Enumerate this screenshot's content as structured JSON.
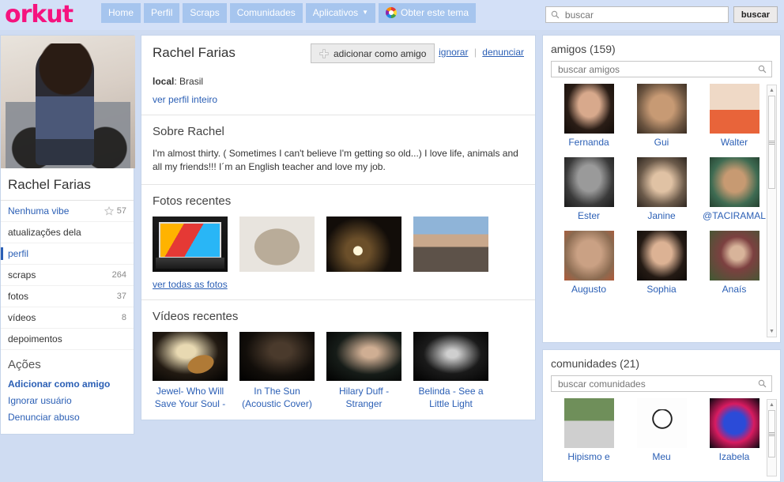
{
  "header": {
    "logo": "orkut",
    "nav": [
      {
        "label": "Home",
        "icon": null,
        "caret": false
      },
      {
        "label": "Perfil",
        "icon": null,
        "caret": false
      },
      {
        "label": "Scraps",
        "icon": null,
        "caret": false
      },
      {
        "label": "Comunidades",
        "icon": null,
        "caret": false
      },
      {
        "label": "Aplicativos",
        "icon": null,
        "caret": true
      },
      {
        "label": "Obter este tema",
        "icon": "palette-icon",
        "caret": false
      }
    ],
    "search": {
      "placeholder": "buscar",
      "value": "",
      "button": "buscar",
      "icon": "search-icon"
    }
  },
  "sidebar": {
    "photo_alt": "foto de perfil",
    "name": "Rachel Farias",
    "vibe": {
      "label": "Nenhuma vibe",
      "icon": "star-icon",
      "count": "57"
    },
    "items": [
      {
        "label": "atualizações dela",
        "count": "",
        "active": false,
        "link": false
      },
      {
        "label": "perfil",
        "count": "",
        "active": true,
        "link": true
      },
      {
        "label": "scraps",
        "count": "264",
        "active": false,
        "link": false
      },
      {
        "label": "fotos",
        "count": "37",
        "active": false,
        "link": false
      },
      {
        "label": "vídeos",
        "count": "8",
        "active": false,
        "link": false
      },
      {
        "label": "depoimentos",
        "count": "",
        "active": false,
        "link": false
      }
    ],
    "actions_title": "Ações",
    "actions": [
      {
        "label": "Adicionar como amigo",
        "bold": true
      },
      {
        "label": "Ignorar usuário",
        "bold": false
      },
      {
        "label": "Denunciar abuso",
        "bold": false
      }
    ]
  },
  "profile": {
    "name": "Rachel Farias",
    "add_friend": {
      "label": "adicionar como amigo",
      "icon": "plus-icon"
    },
    "ignore": "ignorar",
    "separator": "|",
    "report": "denunciar",
    "local_label": "local",
    "local_value": "Brasil",
    "full_profile": "ver perfil inteiro",
    "about_title": "Sobre Rachel",
    "about_text": "I'm almost thirty. ( Sometimes I can't believe I'm getting so old...) I love life, animals and all my friends!!! I´m an English teacher and love my job."
  },
  "photos": {
    "title": "Fotos recentes",
    "view_all": "ver todas as fotos",
    "items": [
      {
        "alt": "foto notebook com imagem de festa"
      },
      {
        "alt": "foto de cachorro shih tzu"
      },
      {
        "alt": "foto de show noturno"
      },
      {
        "alt": "foto de paisagem da cidade"
      }
    ]
  },
  "videos": {
    "title": "Vídeos recentes",
    "items": [
      {
        "title": "Jewel- Who Will Save Your Soul -"
      },
      {
        "title": "In The Sun (Acoustic Cover)"
      },
      {
        "title": "Hilary Duff - Stranger"
      },
      {
        "title": "Belinda - See a Little Light"
      }
    ]
  },
  "friends": {
    "title": "amigos (159)",
    "search": {
      "placeholder": "buscar amigos",
      "value": "",
      "icon": "search-icon"
    },
    "items": [
      {
        "name": "Fernanda"
      },
      {
        "name": "Gui"
      },
      {
        "name": "Walter"
      },
      {
        "name": "Ester"
      },
      {
        "name": "Janine"
      },
      {
        "name": "@TACIRAMAL"
      },
      {
        "name": "Augusto"
      },
      {
        "name": "Sophia"
      },
      {
        "name": "Anaís"
      }
    ]
  },
  "communities": {
    "title": "comunidades (21)",
    "search": {
      "placeholder": "buscar comunidades",
      "value": "",
      "icon": "search-icon"
    },
    "items": [
      {
        "name": "Hipismo e"
      },
      {
        "name": "Meu"
      },
      {
        "name": "Izabela"
      }
    ]
  },
  "colors": {
    "brand_pink": "#f5137f",
    "page_bg": "#cfdcf2",
    "nav_btn": "#a6c5ee",
    "link_blue": "#2b5fb5"
  }
}
